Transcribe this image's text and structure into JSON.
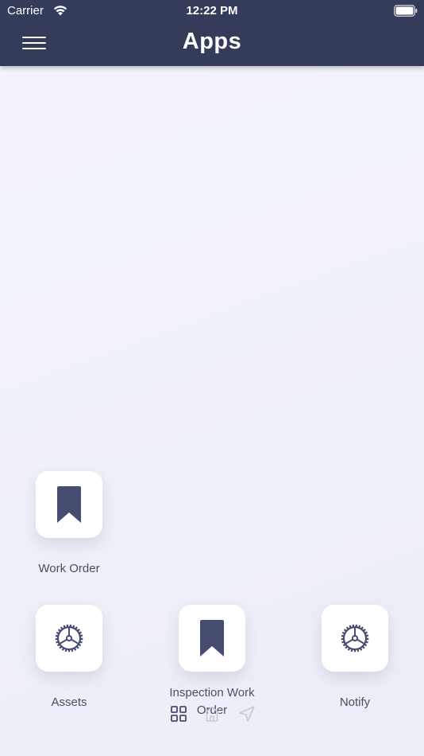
{
  "status_bar": {
    "carrier": "Carrier",
    "time": "12:22 PM"
  },
  "header": {
    "title": "Apps",
    "menu_icon": "hamburger-icon"
  },
  "apps": [
    {
      "label": "Work Order",
      "icon": "bookmark-icon"
    },
    {
      "label": "Assets",
      "icon": "gear-icon"
    },
    {
      "label": "Inspection Work Order",
      "icon": "bookmark-icon"
    },
    {
      "label": "Notify",
      "icon": "gear-icon"
    }
  ],
  "bottom_icons": [
    "grid-icon",
    "home-icon",
    "navigation-icon"
  ],
  "colors": {
    "header_bg": "#343c59",
    "icon": "#474d70",
    "background": "#f0f1f9"
  }
}
